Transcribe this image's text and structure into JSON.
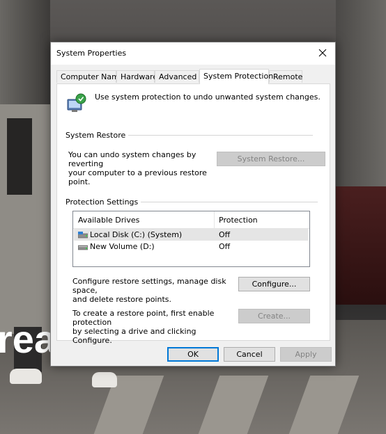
{
  "background": {
    "partial_text": "rea"
  },
  "dialog": {
    "title": "System Properties",
    "close_label": "✕",
    "tabs": [
      {
        "label": "Computer Name"
      },
      {
        "label": "Hardware"
      },
      {
        "label": "Advanced"
      },
      {
        "label": "System Protection",
        "active": true
      },
      {
        "label": "Remote"
      }
    ],
    "intro": "Use system protection to undo unwanted system changes.",
    "system_restore": {
      "group_label": "System Restore",
      "text_line1": "You can undo system changes by reverting",
      "text_line2": "your computer to a previous restore point.",
      "button": "System Restore..."
    },
    "protection": {
      "group_label": "Protection Settings",
      "col_drives": "Available Drives",
      "col_protection": "Protection",
      "drives": [
        {
          "name": "Local Disk (C:) (System)",
          "protection": "Off",
          "icon": "system-drive-icon",
          "selected": true
        },
        {
          "name": "New Volume (D:)",
          "protection": "Off",
          "icon": "drive-icon",
          "selected": false
        }
      ],
      "configure_text_line1": "Configure restore settings, manage disk space,",
      "configure_text_line2": "and delete restore points.",
      "configure_button": "Configure...",
      "create_text_line1": "To create a restore point, first enable protection",
      "create_text_line2": "by selecting a drive and clicking Configure.",
      "create_button": "Create..."
    },
    "footer": {
      "ok": "OK",
      "cancel": "Cancel",
      "apply": "Apply"
    },
    "colors": {
      "accent": "#0078d7",
      "dialog_bg": "#f0f0f0",
      "panel_bg": "#ffffff"
    }
  }
}
